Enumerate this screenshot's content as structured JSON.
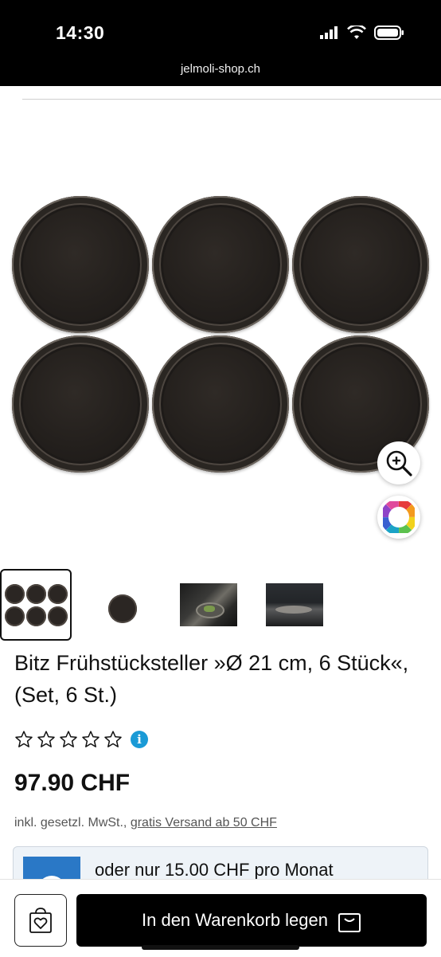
{
  "status_bar": {
    "time": "14:30",
    "url": "jelmoli-shop.ch"
  },
  "product": {
    "title": "Bitz Frühstücksteller »Ø 21 cm, 6 Stück«, (Set, 6 St.)",
    "rating_stars": 0,
    "rating_max": 5,
    "price": "97.90 CHF",
    "tax_prefix": "inkl. gesetzl. MwSt.,",
    "shipping_link": "gratis Versand ab 50 CHF"
  },
  "financing": {
    "text": "oder nur 15.00 CHF pro Monat"
  },
  "actions": {
    "cart_label": "In den Warenkorb legen"
  },
  "icons": {
    "zoom": "zoom-in-icon",
    "color": "color-wheel-icon",
    "wishlist": "heart-bag-icon",
    "cart": "shopping-bag-icon",
    "info": "info-icon"
  },
  "colors": {
    "info_blue": "#1a9ad6",
    "button_black": "#000000",
    "finance_bg": "#eef3f8"
  }
}
